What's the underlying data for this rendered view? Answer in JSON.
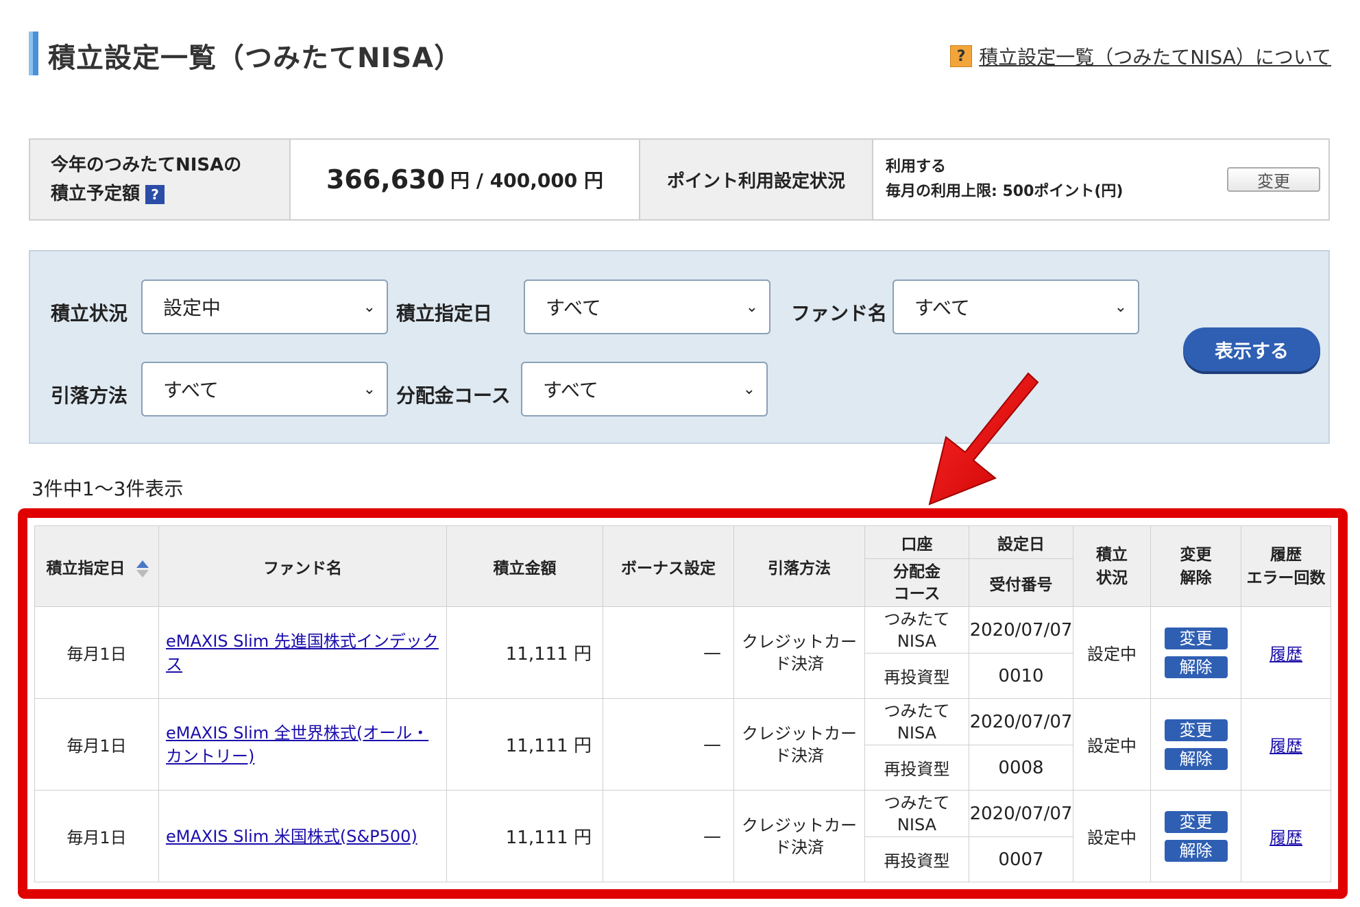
{
  "header": {
    "title": "積立設定一覧（つみたてNISA）",
    "help_icon": "?",
    "help_link": "積立設定一覧（つみたてNISA）について"
  },
  "summary": {
    "label_line1": "今年のつみたてNISAの",
    "label_line2": "積立予定額",
    "label_icon": "?",
    "amount": "366,630",
    "amount_unit": "円 / 400,000 円",
    "point_label": "ポイント利用設定状況",
    "point_status": "利用する",
    "point_limit": "毎月の利用上限: 500ポイント(円)",
    "change_button": "変更"
  },
  "filters": {
    "status_label": "積立状況",
    "status_value": "設定中",
    "date_label": "積立指定日",
    "date_value": "すべて",
    "fund_label": "ファンド名",
    "fund_value": "すべて",
    "method_label": "引落方法",
    "method_value": "すべて",
    "course_label": "分配金コース",
    "course_value": "すべて",
    "show_button": "表示する"
  },
  "count_text": "3件中1～3件表示",
  "table": {
    "headers": {
      "date": "積立指定日",
      "fund": "ファンド名",
      "amount": "積立金額",
      "bonus": "ボーナス設定",
      "method": "引落方法",
      "account": "口座",
      "course_l1": "分配金",
      "course_l2": "コース",
      "setdate": "設定日",
      "receipt": "受付番号",
      "status_l1": "積立",
      "status_l2": "状況",
      "change_l1": "変更",
      "change_l2": "解除",
      "history_l1": "履歴",
      "history_l2": "エラー回数"
    },
    "rows": [
      {
        "date": "毎月1日",
        "fund": "eMAXIS Slim 先進国株式インデックス",
        "amount": "11,111 円",
        "bonus": "—",
        "method": "クレジットカード決済",
        "account_l1": "つみたて",
        "account_l2": "NISA",
        "setdate": "2020/07/07",
        "course": "再投資型",
        "receipt": "0010",
        "status": "設定中",
        "change": "変更",
        "cancel": "解除",
        "history": "履歴"
      },
      {
        "date": "毎月1日",
        "fund": "eMAXIS Slim 全世界株式(オール・カントリー)",
        "amount": "11,111 円",
        "bonus": "—",
        "method": "クレジットカード決済",
        "account_l1": "つみたて",
        "account_l2": "NISA",
        "setdate": "2020/07/07",
        "course": "再投資型",
        "receipt": "0008",
        "status": "設定中",
        "change": "変更",
        "cancel": "解除",
        "history": "履歴"
      },
      {
        "date": "毎月1日",
        "fund": "eMAXIS Slim 米国株式(S&P500)",
        "amount": "11,111 円",
        "bonus": "—",
        "method": "クレジットカード決済",
        "account_l1": "つみたて",
        "account_l2": "NISA",
        "setdate": "2020/07/07",
        "course": "再投資型",
        "receipt": "0007",
        "status": "設定中",
        "change": "変更",
        "cancel": "解除",
        "history": "履歴"
      }
    ]
  },
  "colors": {
    "accent_blue": "#2f5fb3",
    "highlight_red": "#e00000",
    "filter_bg": "#dfe9f2"
  }
}
